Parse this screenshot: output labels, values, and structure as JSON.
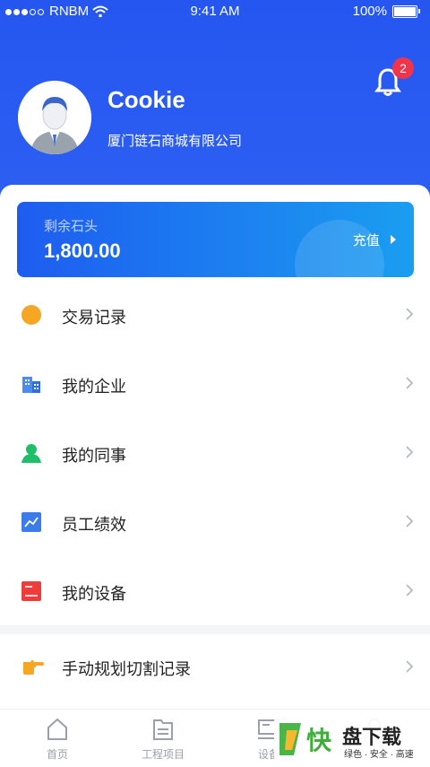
{
  "status_bar": {
    "carrier": "RNBM",
    "time": "9:41 AM",
    "battery": "100%"
  },
  "header": {
    "username": "Cookie",
    "company": "厦门链石商城有限公司",
    "notification_count": "2"
  },
  "balance": {
    "label": "剩余石头",
    "amount": "1,800.00",
    "action": "充值"
  },
  "menu": [
    {
      "label": "交易记录",
      "icon": "coin-icon",
      "color": "#f5a623"
    },
    {
      "label": "我的企业",
      "icon": "building-icon",
      "color": "#3b82f6"
    },
    {
      "label": "我的同事",
      "icon": "person-icon",
      "color": "#22c55e"
    },
    {
      "label": "员工绩效",
      "icon": "chart-icon",
      "color": "#3b82f6"
    },
    {
      "label": "我的设备",
      "icon": "device-icon",
      "color": "#ef4444"
    }
  ],
  "menu2": {
    "label": "手动规划切割记录",
    "icon": "pointing-hand-icon",
    "color": "#f5a623"
  },
  "tabbar": [
    {
      "label": "首页",
      "icon": "home-icon"
    },
    {
      "label": "工程项目",
      "icon": "folder-icon"
    },
    {
      "label": "设备",
      "icon": "computer-icon"
    },
    {
      "label": "",
      "icon": "profile-icon"
    }
  ],
  "watermark": {
    "brand": "快",
    "title": "盘下载",
    "slogan": "绿色 · 安全 · 高速"
  },
  "colors": {
    "primary": "#2556f0",
    "badge": "#f2344b"
  }
}
